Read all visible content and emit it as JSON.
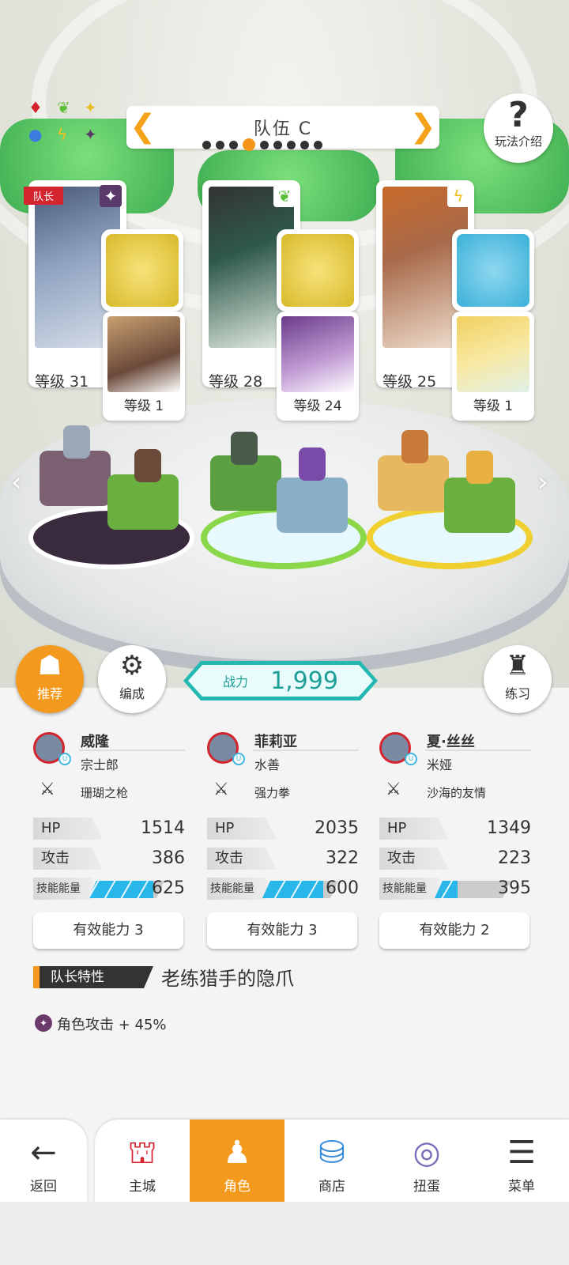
{
  "header": {
    "team_title": "队伍 C",
    "help_label": "玩法介绍",
    "team_dots": 9,
    "active_dot": 3
  },
  "cards": [
    {
      "leader_tag": "队长",
      "level": "等级 31",
      "element_icon": "dark-star-icon",
      "sub_level": "等级 1",
      "sub_element": "grass-leaf-icon"
    },
    {
      "leader_tag": "",
      "level": "等级 28",
      "element_icon": "grass-leaf-icon",
      "sub_level": "等级 24",
      "sub_element": "water-circle-icon"
    },
    {
      "leader_tag": "",
      "level": "等级 25",
      "element_icon": "thunder-bolt-icon",
      "sub_level": "等级 1",
      "sub_element": "grass-leaf-icon"
    }
  ],
  "actions": {
    "recommend": "推荐",
    "formation": "编成",
    "practice": "练习",
    "power_label": "战力",
    "power_value": "1,999"
  },
  "heroes": [
    {
      "name": "威隆",
      "partner": "宗士郎",
      "weapon": "珊瑚之枪",
      "hp_label": "HP",
      "hp": "1514",
      "atk_label": "攻击",
      "atk": "386",
      "energy_label": "技能能量",
      "energy": "625",
      "energy_fill": 0.85,
      "ability": "有效能力 3"
    },
    {
      "name": "菲莉亚",
      "partner": "水善",
      "weapon": "强力拳",
      "hp_label": "HP",
      "hp": "2035",
      "atk_label": "攻击",
      "atk": "322",
      "energy_label": "技能能量",
      "energy": "600",
      "energy_fill": 0.8,
      "ability": "有效能力 3"
    },
    {
      "name": "夏·丝丝",
      "partner": "米娅",
      "weapon": "沙海的友情",
      "hp_label": "HP",
      "hp": "1349",
      "atk_label": "攻击",
      "atk": "223",
      "energy_label": "技能能量",
      "energy": "395",
      "energy_fill": 0.3,
      "ability": "有效能力 2"
    }
  ],
  "leader_trait": {
    "label": "队长特性",
    "name": "老练猎手的隐爪",
    "effect": "角色攻击 + 45%"
  },
  "nav": {
    "back": "返回",
    "items": [
      "主城",
      "角色",
      "商店",
      "扭蛋",
      "菜单"
    ],
    "selected": "角色"
  },
  "colors": {
    "accent": "#f39a1e",
    "power": "#23b8b2",
    "energy": "#29b6e8",
    "leader": "#d4252f"
  }
}
